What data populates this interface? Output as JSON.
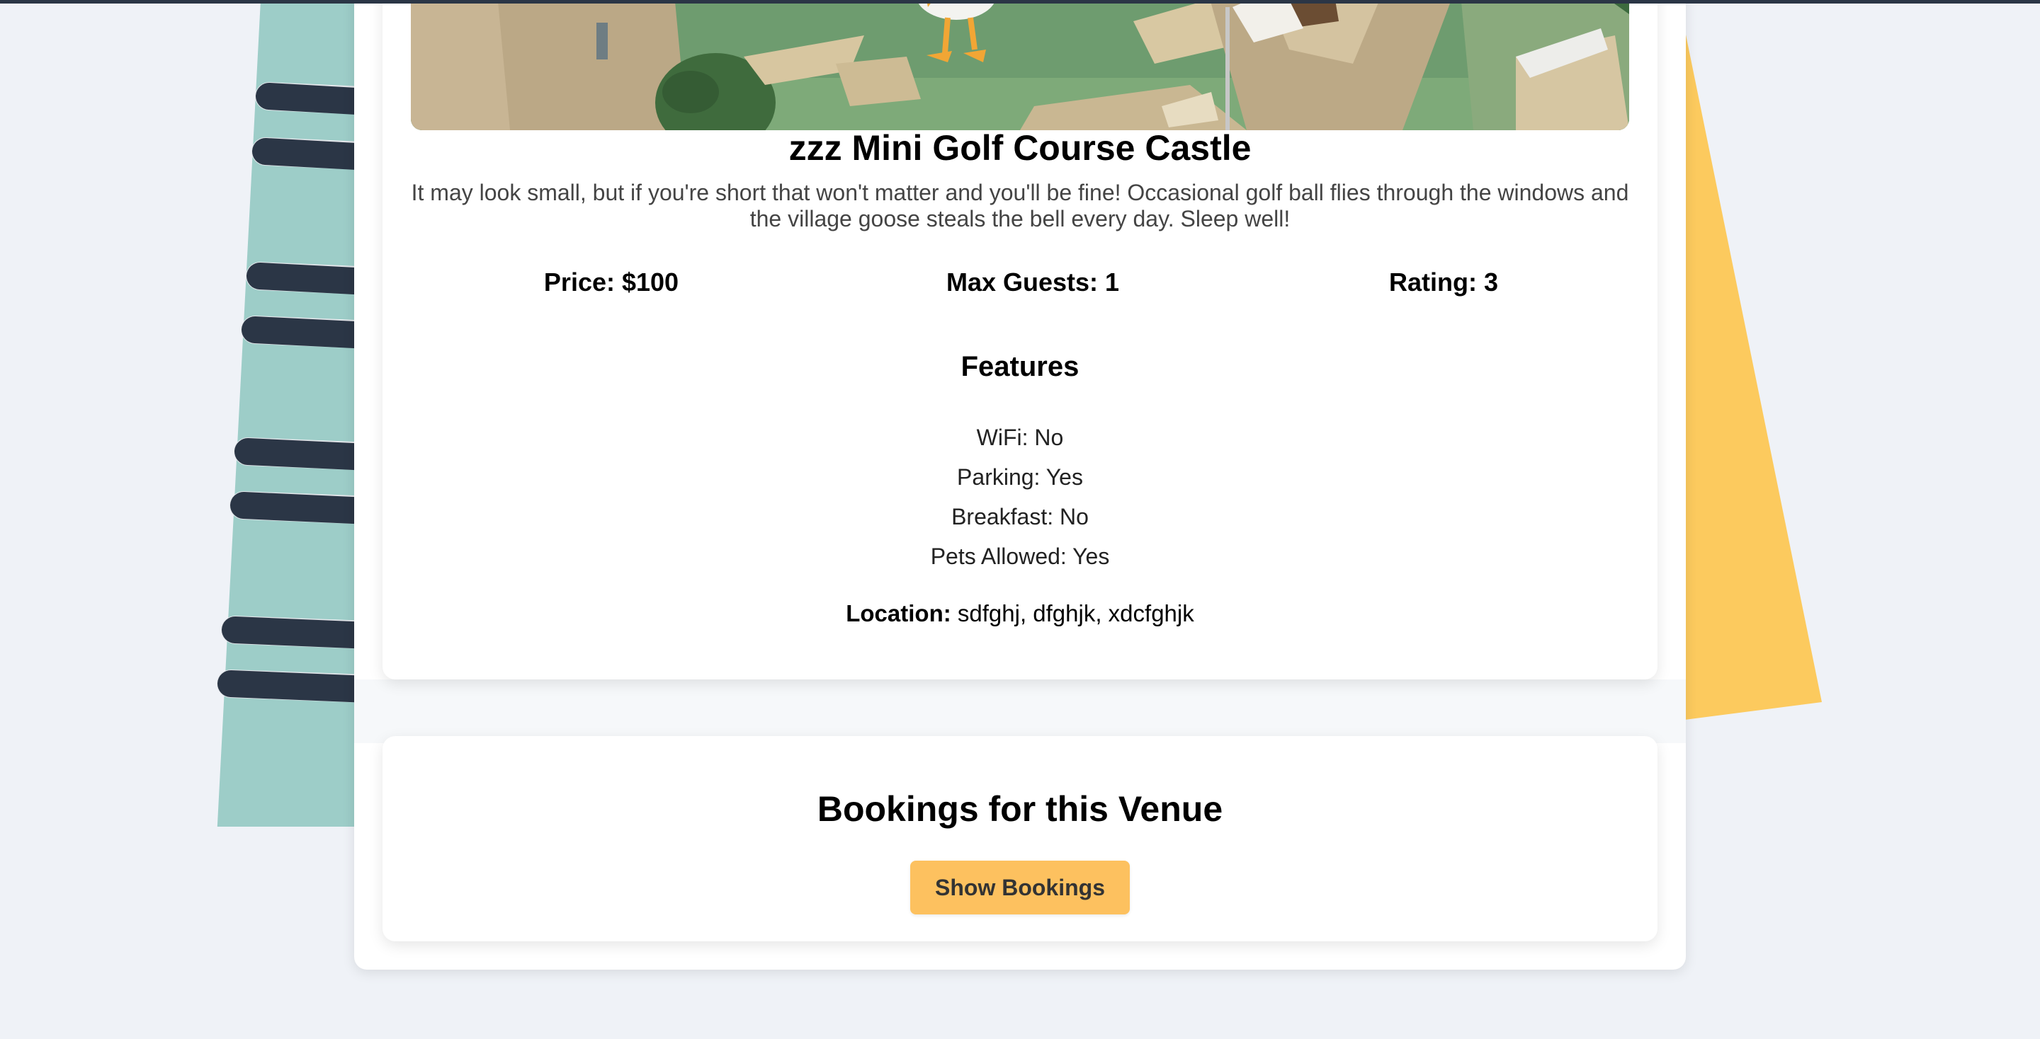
{
  "venue": {
    "name": "zzz Mini Golf Course Castle",
    "description": "It may look small, but if you're short that won't matter and you'll be fine! Occasional golf ball flies through the windows and the village goose steals the bell every day. Sleep well!",
    "price": "Price: $100",
    "max_guests": "Max Guests: 1",
    "rating": "Rating: 3",
    "features_heading": "Features",
    "features": [
      "WiFi: No",
      "Parking: Yes",
      "Breakfast: No",
      "Pets Allowed: Yes"
    ],
    "location_label": "Location:",
    "location_value": "sdfghj, dfghjk, xdcfghjk"
  },
  "bookings": {
    "heading": "Bookings for this Venue",
    "button_label": "Show Bookings"
  },
  "colors": {
    "background": "#eff2f7",
    "accent": "#fdc15f",
    "notebook_teal": "#9dcdc8",
    "notebook_yellow": "#fcca5e",
    "spiral": "#2b3646"
  }
}
